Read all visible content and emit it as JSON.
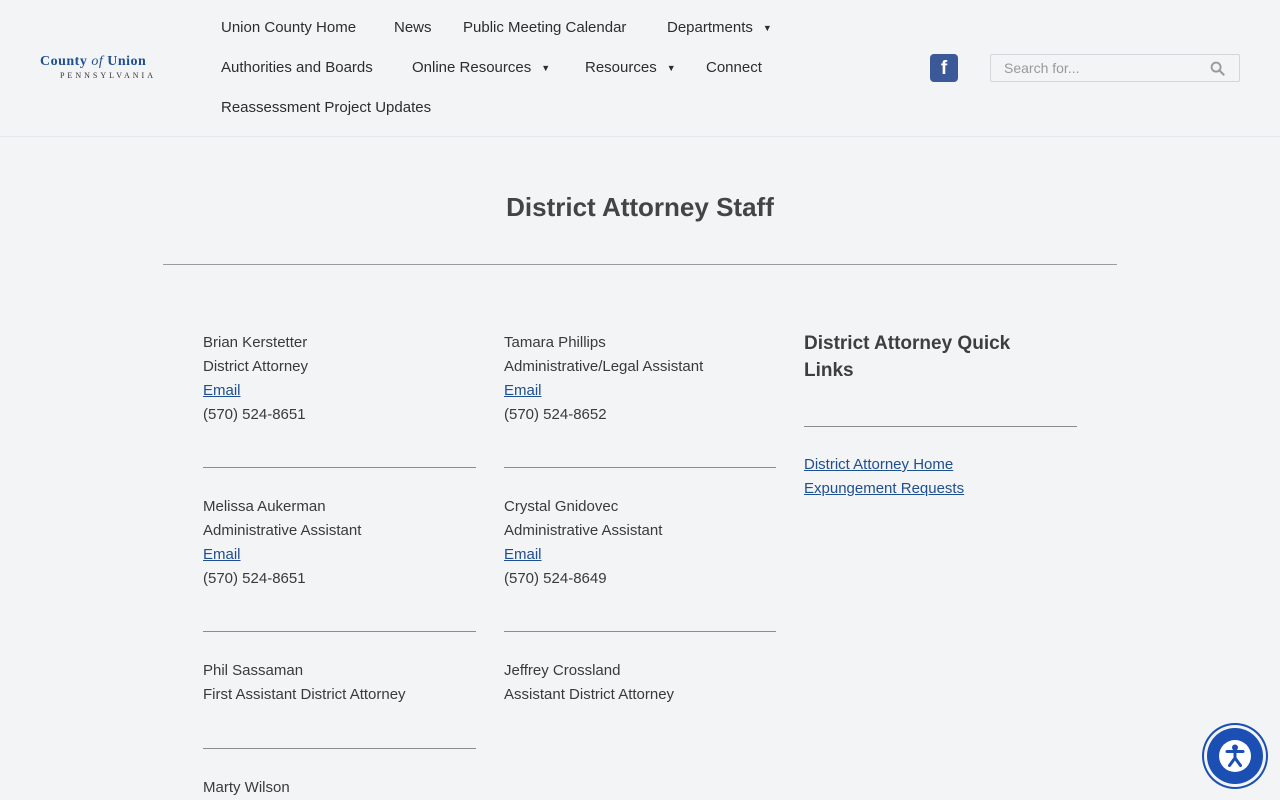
{
  "header": {
    "logo": {
      "line1_a": "County",
      "line1_of": "of",
      "line1_b": "Union",
      "line2": "PENNSYLVANIA"
    },
    "nav": [
      {
        "label": "Union County Home"
      },
      {
        "label": "News"
      },
      {
        "label": "Public Meeting Calendar"
      },
      {
        "label": "Departments",
        "dropdown": true
      },
      {
        "label": "Authorities and Boards"
      },
      {
        "label": "Online Resources",
        "dropdown": true
      },
      {
        "label": "Resources",
        "dropdown": true
      },
      {
        "label": "Connect"
      },
      {
        "label": "Reassessment Project Updates"
      }
    ],
    "facebook_glyph": "f",
    "search": {
      "placeholder": "Search for..."
    }
  },
  "main": {
    "title": "District Attorney Staff",
    "staff": [
      {
        "name": "Brian Kerstetter",
        "role": "District Attorney",
        "email_label": "Email",
        "phone": "(570) 524-8651"
      },
      {
        "name": "Tamara Phillips",
        "role": "Administrative/Legal Assistant",
        "email_label": "Email",
        "phone": "(570) 524-8652"
      },
      {
        "name": "Melissa Aukerman",
        "role": "Administrative Assistant",
        "email_label": "Email",
        "phone": "(570) 524-8651"
      },
      {
        "name": "Crystal Gnidovec",
        "role": "Administrative Assistant",
        "email_label": "Email",
        "phone": "(570) 524-8649"
      },
      {
        "name": "Phil Sassaman",
        "role": "First Assistant District Attorney"
      },
      {
        "name": "Jeffrey Crossland",
        "role": "Assistant District Attorney"
      },
      {
        "name": "Marty Wilson"
      }
    ],
    "quick_links": {
      "title": "District Attorney Quick Links",
      "links": [
        "District Attorney Home",
        "Expungement Requests"
      ]
    }
  },
  "colors": {
    "link": "#1e4f8f",
    "facebook": "#3b5998",
    "accessibility": "#1b4fb3"
  }
}
